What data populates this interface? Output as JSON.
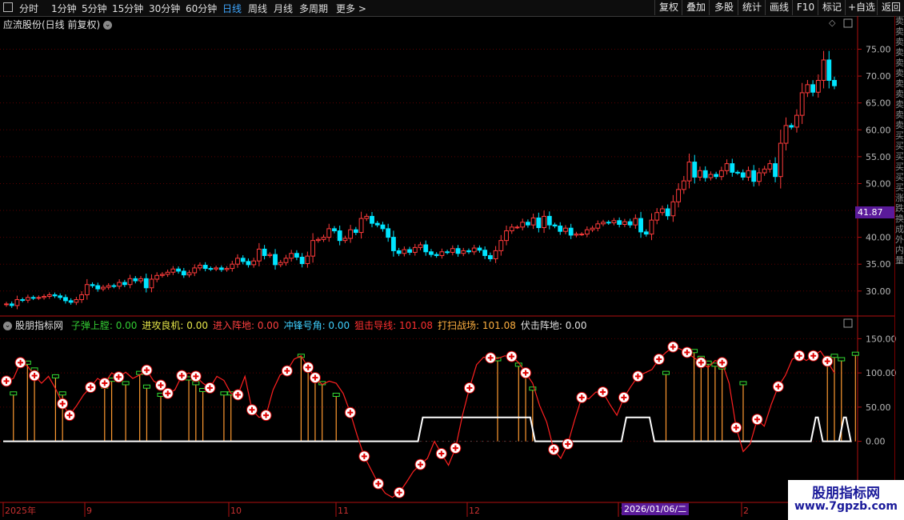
{
  "toolbar": {
    "periods": [
      "分时",
      "1分钟",
      "5分钟",
      "15分钟",
      "30分钟",
      "60分钟",
      "日线",
      "周线",
      "月线",
      "多周期",
      "更多 >"
    ],
    "active_period": "日线",
    "right_buttons": [
      "复权",
      "叠加",
      "多股",
      "统计",
      "画线",
      "F10",
      "标记",
      "+自选",
      "返回"
    ]
  },
  "chart_header": {
    "title": "应流股份(日线 前复权)"
  },
  "price_tag": "41.87",
  "indicator": {
    "name": "股朋指标网",
    "items": [
      {
        "label": "子弹上膛: 0.00",
        "color": "#33cc33"
      },
      {
        "label": "进攻良机: 0.00",
        "color": "#e8e84a"
      },
      {
        "label": "进入阵地: 0.00",
        "color": "#ff4040"
      },
      {
        "label": "冲锋号角: 0.00",
        "color": "#40d0ff"
      },
      {
        "label": "狙击导线: 101.08",
        "color": "#ff3030"
      },
      {
        "label": "打扫战场: 101.08",
        "color": "#ffb040"
      },
      {
        "label": "伏击阵地: 0.00",
        "color": "#e0e0e0"
      }
    ]
  },
  "date_tag": "2026/01/06/二",
  "watermark": {
    "line1": "股朋指标网",
    "line2": "www.7gpzb.com"
  },
  "colors": {
    "up": "#ff3b3b",
    "down": "#00e5ff",
    "grid": "#5a0000",
    "axis": "#b01010"
  },
  "chart_data": [
    {
      "type": "candlestick",
      "title": "应流股份(日线 前复权)",
      "y_ticks": [
        30,
        35,
        40,
        45,
        50,
        55,
        60,
        65,
        70,
        75
      ],
      "y_tick_labels": [
        "30.00",
        "35.00",
        "40.00",
        "45.00",
        "50.00",
        "55.00",
        "60.00",
        "65.00",
        "70.00",
        "75.00"
      ],
      "ylim": [
        25.8,
        78.5
      ],
      "closes": [
        27.6,
        27.3,
        28.4,
        28.3,
        28.8,
        28.7,
        28.8,
        29.0,
        29.3,
        29.1,
        28.8,
        28.2,
        27.9,
        28.4,
        29.3,
        31.2,
        31.0,
        30.4,
        30.7,
        31.0,
        30.9,
        31.6,
        31.2,
        32.3,
        31.9,
        32.3,
        30.6,
        32.2,
        32.9,
        33.1,
        33.5,
        34.1,
        33.7,
        33.0,
        33.4,
        34.3,
        34.8,
        34.2,
        34.1,
        34.3,
        34.0,
        34.2,
        35.0,
        36.1,
        35.5,
        34.9,
        35.6,
        37.8,
        36.6,
        36.8,
        34.9,
        35.3,
        36.1,
        37.0,
        36.3,
        35.1,
        36.5,
        39.4,
        39.6,
        40.0,
        41.6,
        41.2,
        39.4,
        39.8,
        41.4,
        40.9,
        43.5,
        43.9,
        42.6,
        42.3,
        41.6,
        40.0,
        37.5,
        37.0,
        37.7,
        37.2,
        38.1,
        38.6,
        37.3,
        36.8,
        36.6,
        37.3,
        37.2,
        37.9,
        37.0,
        37.5,
        37.3,
        38.0,
        37.6,
        36.6,
        36.0,
        37.5,
        39.4,
        41.2,
        41.9,
        41.9,
        42.8,
        42.3,
        43.6,
        41.8,
        43.9,
        42.3,
        42.1,
        41.1,
        41.7,
        40.4,
        40.6,
        40.6,
        41.4,
        41.7,
        42.5,
        42.8,
        42.7,
        43.1,
        42.4,
        42.9,
        42.3,
        43.5,
        41.0,
        40.6,
        43.2,
        44.6,
        45.3,
        44.0,
        46.6,
        48.9,
        50.5,
        54.0,
        51.2,
        52.4,
        51.1,
        51.7,
        51.3,
        52.4,
        53.7,
        52.1,
        52.0,
        51.2,
        52.4,
        50.4,
        52.0,
        52.7,
        53.7,
        51.3,
        57.5,
        60.8,
        60.5,
        62.7,
        66.9,
        68.4,
        67.0,
        69.2,
        73.0,
        69.2,
        68.2
      ],
      "x_labels": [
        "2025年",
        "9",
        "10",
        "11",
        "12",
        "1",
        "2"
      ]
    },
    {
      "type": "indicator",
      "title": "股朋指标网",
      "y_ticks": [
        0,
        50,
        100,
        150
      ],
      "y_tick_labels": [
        "0.00",
        "50.00",
        "100.00",
        "150.00"
      ],
      "ylim": [
        -80,
        168
      ],
      "line_values": [
        88,
        92,
        115,
        110,
        96,
        85,
        95,
        77,
        55,
        38,
        52,
        68,
        79,
        92,
        85,
        100,
        94,
        101,
        92,
        97,
        104,
        88,
        82,
        70,
        75,
        96,
        100,
        95,
        85,
        78,
        95,
        89,
        70,
        68,
        95,
        46,
        35,
        38,
        75,
        97,
        103,
        120,
        125,
        108,
        93,
        83,
        88,
        85,
        70,
        42,
        8,
        -22,
        -42,
        -62,
        -76,
        -82,
        -75,
        -60,
        -44,
        -34,
        -25,
        0,
        -18,
        -35,
        -10,
        38,
        78,
        112,
        123,
        122,
        121,
        125,
        124,
        115,
        100,
        85,
        52,
        28,
        -12,
        -25,
        -4,
        32,
        64,
        62,
        72,
        72,
        54,
        38,
        64,
        80,
        95,
        100,
        105,
        120,
        130,
        138,
        135,
        130,
        122,
        115,
        108,
        118,
        115,
        85,
        20,
        -15,
        -4,
        32,
        22,
        54,
        80,
        96,
        120,
        125,
        118,
        125,
        132,
        117,
        100
      ],
      "bar_values": [
        0,
        70,
        0,
        115,
        105,
        0,
        0,
        95,
        70,
        0,
        0,
        0,
        0,
        0,
        80,
        90,
        0,
        85,
        0,
        100,
        80,
        0,
        68,
        0,
        0,
        0,
        92,
        85,
        75,
        0,
        0,
        70,
        70,
        0,
        0,
        0,
        0,
        0,
        0,
        0,
        0,
        0,
        125,
        105,
        92,
        85,
        0,
        68,
        0,
        0,
        0,
        0,
        0,
        0,
        0,
        0,
        0,
        0,
        0,
        0,
        0,
        0,
        0,
        0,
        0,
        0,
        0,
        0,
        0,
        0,
        120,
        0,
        0,
        112,
        100,
        77,
        0,
        0,
        0,
        0,
        0,
        0,
        0,
        0,
        0,
        0,
        0,
        0,
        0,
        0,
        0,
        0,
        0,
        0,
        100,
        0,
        0,
        0,
        132,
        122,
        115,
        112,
        108,
        0,
        0,
        85,
        0,
        0,
        0,
        0,
        0,
        0,
        0,
        0,
        0,
        0,
        0,
        122,
        125,
        120,
        0,
        128,
        0,
        0
      ],
      "rect_ranges": [
        [
          59,
          75
        ],
        [
          88,
          92
        ],
        [
          115,
          116
        ],
        [
          119,
          120
        ]
      ],
      "circle_indices": [
        0,
        2,
        4,
        8,
        9,
        12,
        14,
        16,
        20,
        22,
        23,
        25,
        27,
        29,
        33,
        35,
        37,
        40,
        43,
        44,
        49,
        51,
        53,
        56,
        59,
        62,
        64,
        66,
        69,
        72,
        74,
        78,
        80,
        82,
        85,
        88,
        90,
        93,
        95,
        97,
        99,
        102,
        104,
        107,
        110,
        113,
        115,
        117,
        120,
        121,
        122,
        125,
        127,
        129,
        131,
        134,
        138,
        140,
        142,
        145,
        147,
        149,
        151,
        153,
        155,
        159
      ]
    }
  ]
}
